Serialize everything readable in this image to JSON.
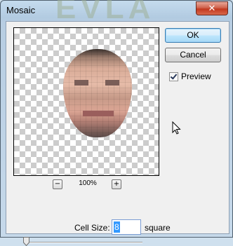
{
  "window": {
    "title": "Mosaic",
    "close_glyph": "✕"
  },
  "preview": {
    "zoom_level": "100%",
    "zoom_out_glyph": "−",
    "zoom_in_glyph": "+"
  },
  "buttons": {
    "ok_label": "OK",
    "cancel_label": "Cancel"
  },
  "preview_toggle": {
    "label": "Preview",
    "checked": true
  },
  "cell_size": {
    "label": "Cell Size:",
    "value": "8",
    "unit": "square",
    "slider_fraction": 0.0
  },
  "colors": {
    "accent": "#3399ff",
    "close": "#c2391f"
  },
  "icons": [
    "close-icon",
    "zoom-out-icon",
    "zoom-in-icon",
    "checkmark-icon",
    "mouse-cursor-icon",
    "slider-thumb-icon"
  ]
}
